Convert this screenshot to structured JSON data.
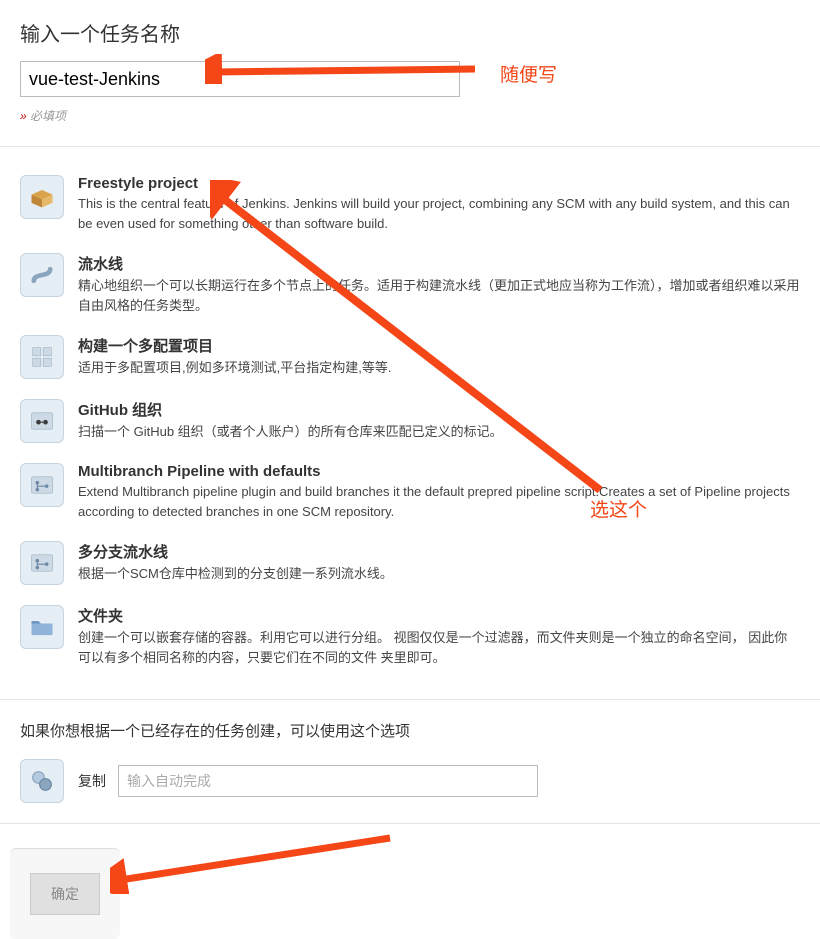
{
  "header": {
    "title": "输入一个任务名称",
    "name_value": "vue-test-Jenkins",
    "required_note": "必填项"
  },
  "annotations": {
    "name_note": "随便写",
    "select_note": "选这个"
  },
  "project_types": [
    {
      "id": "freestyle",
      "title": "Freestyle project",
      "desc": "This is the central feature of Jenkins. Jenkins will build your project, combining any SCM with any build system, and this can be even used for something other than software build.",
      "icon": "box-icon"
    },
    {
      "id": "pipeline",
      "title": "流水线",
      "desc": "精心地组织一个可以长期运行在多个节点上的任务。适用于构建流水线（更加正式地应当称为工作流），增加或者组织难以采用自由风格的任务类型。",
      "icon": "pipe-icon"
    },
    {
      "id": "matrix",
      "title": "构建一个多配置项目",
      "desc": "适用于多配置项目,例如多环境测试,平台指定构建,等等.",
      "icon": "matrix-icon"
    },
    {
      "id": "github-org",
      "title": "GitHub 组织",
      "desc": "扫描一个 GitHub 组织（或者个人账户）的所有仓库来匹配已定义的标记。",
      "icon": "github-icon"
    },
    {
      "id": "multibranch-defaults",
      "title": "Multibranch Pipeline with defaults",
      "desc": "Extend Multibranch pipeline plugin and build branches it the default prepred pipeline script.Creates a set of Pipeline projects according to detected branches in one SCM repository.",
      "icon": "branch-icon"
    },
    {
      "id": "multibranch",
      "title": "多分支流水线",
      "desc": "根据一个SCM仓库中检测到的分支创建一系列流水线。",
      "icon": "branch-icon"
    },
    {
      "id": "folder",
      "title": "文件夹",
      "desc": "创建一个可以嵌套存储的容器。利用它可以进行分组。 视图仅仅是一个过滤器，而文件夹则是一个独立的命名空间， 因此你可以有多个相同名称的内容，只要它们在不同的文件 夹里即可。",
      "icon": "folder-icon"
    }
  ],
  "copy": {
    "prompt": "如果你想根据一个已经存在的任务创建，可以使用这个选项",
    "label": "复制",
    "placeholder": "输入自动完成"
  },
  "footer": {
    "ok_label": "确定"
  },
  "colors": {
    "annotation": "#f44617"
  }
}
